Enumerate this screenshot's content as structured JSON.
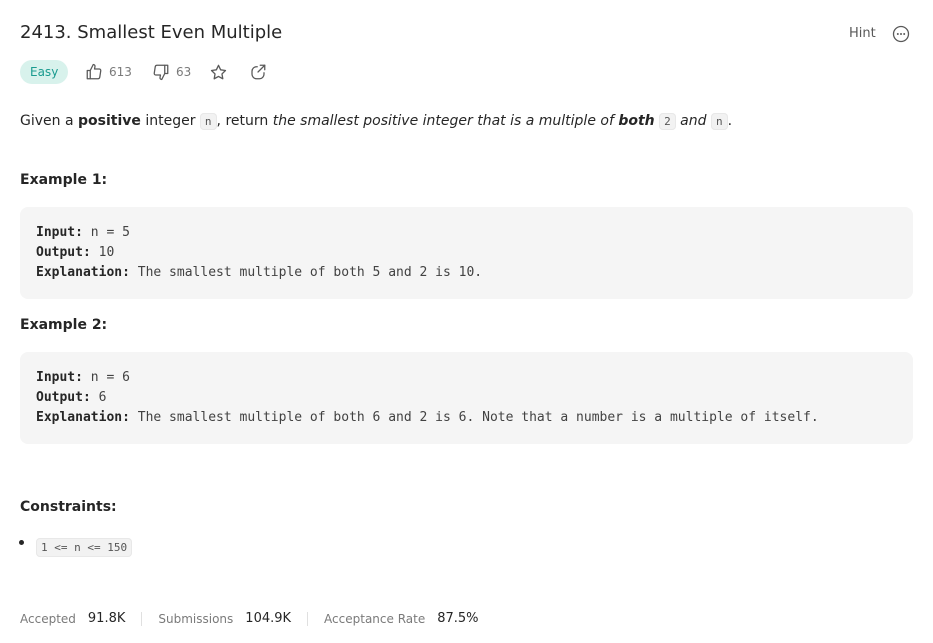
{
  "problem": {
    "title": "2413. Smallest Even Multiple",
    "hint_label": "Hint",
    "more_icon": "more-horizontal-icon",
    "difficulty": "Easy",
    "likes": "613",
    "dislikes": "63"
  },
  "description": {
    "p1": "Given a ",
    "p2": "positive",
    "p3": " integer ",
    "code_n": "n",
    "p4": ", return ",
    "p5": "the smallest positive integer that is a multiple of ",
    "p6": "both",
    "code_2": "2",
    "p7": " and ",
    "code_n2": "n",
    "p8": "."
  },
  "examples": [
    {
      "title": "Example 1:",
      "input_label": "Input:",
      "input": "n = 5",
      "output_label": "Output:",
      "output": "10",
      "explanation_label": "Explanation:",
      "explanation": "The smallest multiple of both 5 and 2 is 10."
    },
    {
      "title": "Example 2:",
      "input_label": "Input:",
      "input": "n = 6",
      "output_label": "Output:",
      "output": "6",
      "explanation_label": "Explanation:",
      "explanation": "The smallest multiple of both 6 and 2 is 6. Note that a number is a multiple of itself."
    }
  ],
  "constraints": {
    "title": "Constraints:",
    "items": [
      "1 <= n <= 150"
    ]
  },
  "stats": {
    "accepted_label": "Accepted",
    "accepted": "91.8K",
    "submissions_label": "Submissions",
    "submissions": "104.9K",
    "rate_label": "Acceptance Rate",
    "rate": "87.5%"
  },
  "colors": {
    "easy_bg": "#d8f2ec",
    "easy_text": "#1a9b8f",
    "code_bg": "#f5f5f5"
  }
}
